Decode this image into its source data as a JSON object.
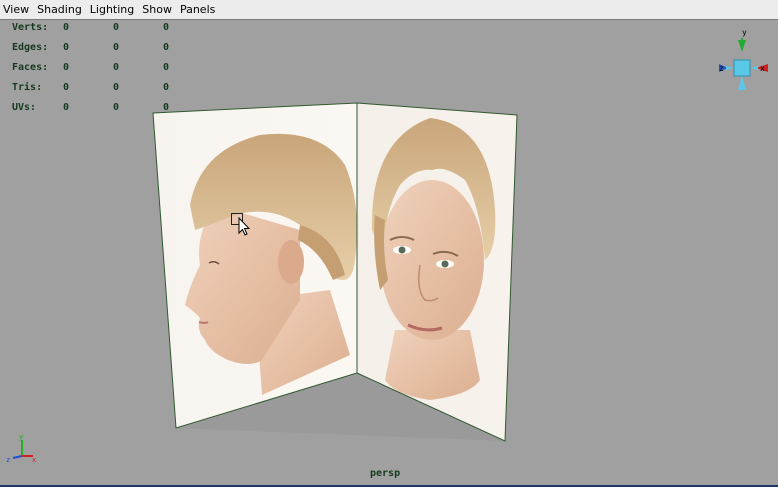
{
  "menu": {
    "items": [
      "View",
      "Shading",
      "Lighting",
      "Show",
      "Panels"
    ]
  },
  "hud": {
    "rows": [
      {
        "label": "Verts:",
        "values": [
          "0",
          "0",
          "0"
        ]
      },
      {
        "label": "Edges:",
        "values": [
          "0",
          "0",
          "0"
        ]
      },
      {
        "label": "Faces:",
        "values": [
          "0",
          "0",
          "0"
        ]
      },
      {
        "label": "Tris:",
        "values": [
          "0",
          "0",
          "0"
        ]
      },
      {
        "label": "UVs:",
        "values": [
          "0",
          "0",
          "0"
        ]
      }
    ]
  },
  "camera": {
    "name": "persp"
  },
  "view_cube": {
    "axis_labels": [
      "y",
      "z",
      "x"
    ]
  },
  "axis_indicator": {
    "labels": [
      "y",
      "z",
      "x"
    ]
  },
  "colors": {
    "viewport_bg": "#a0a0a0",
    "hud_text": "#143a1e",
    "axis_x": "#d02020",
    "axis_y": "#20b020",
    "axis_z": "#2050d0"
  },
  "icons": [
    "arrow-cursor-icon",
    "view-cube-icon",
    "axis-indicator-icon"
  ]
}
